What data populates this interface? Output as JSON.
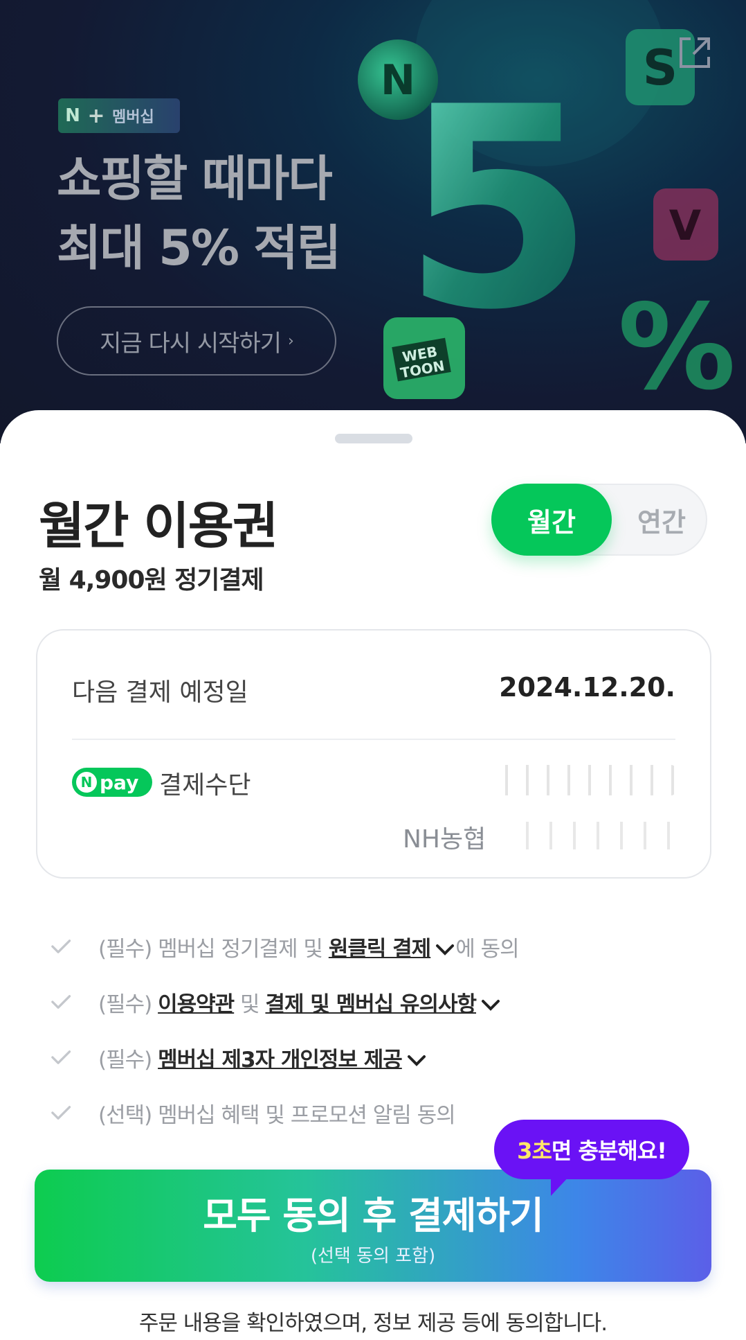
{
  "banner": {
    "brand_badge": {
      "n": "N",
      "plus": "+",
      "label": "멤버십"
    },
    "headline_line1": "쇼핑할 때마다",
    "headline_line2": "최대 5% 적립",
    "restart_button": "지금 다시 시작하기",
    "art_text": {
      "big_number": "5",
      "percent": "%",
      "webtoon1": "WEB",
      "webtoon2": "TOON",
      "coin": "N"
    }
  },
  "sheet": {
    "title": "월간 이용권",
    "subtitle": "월 4,900원 정기결제",
    "toggle": {
      "monthly": "월간",
      "yearly": "연간",
      "selected": "monthly"
    },
    "next_payment": {
      "label": "다음 결제 예정일",
      "value": "2024.12.20."
    },
    "payment_method": {
      "badge_n": "N",
      "badge_text": "pay",
      "label": "결제수단",
      "bank": "NH농협"
    },
    "agreements": [
      {
        "prefix": "(필수) 멤버십 정기결제 및 ",
        "link": "원클릭 결제",
        "suffix": "에 동의"
      },
      {
        "prefix": "(필수) ",
        "link": "이용약관",
        "middle": " 및 ",
        "link2": "결제 및 멤버십 유의사항"
      },
      {
        "prefix": "(필수) ",
        "link": "멤버십 제3자 개인정보 제공"
      },
      {
        "prefix": "(선택) 멤버십 혜택 및 프로모션 알림 동의"
      }
    ],
    "tooltip": {
      "highlight": "3초",
      "rest": "면 충분해요!"
    },
    "cta": {
      "main": "모두 동의 후 결제하기",
      "sub": "(선택 동의 포함)"
    },
    "footnote": "주문 내용을 확인하였으며, 정보 제공 등에 동의합니다."
  },
  "colors": {
    "brand_green": "#05c75a",
    "tooltip_purple": "#6a12f5",
    "banner_bg": "#131a33"
  }
}
